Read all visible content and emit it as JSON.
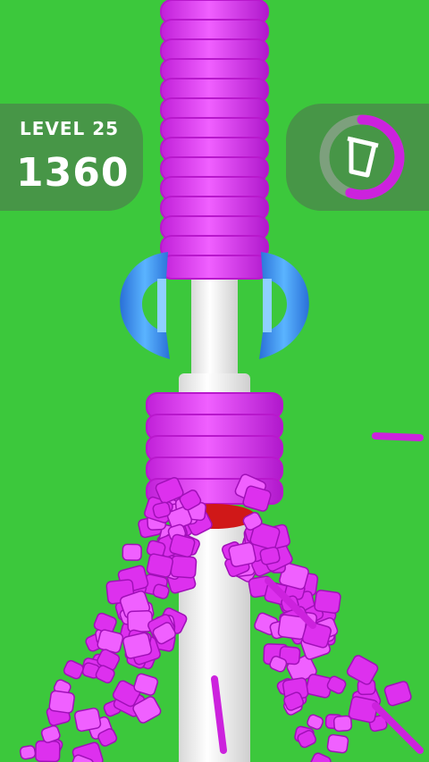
{
  "hud": {
    "level_label": "LEVEL 25",
    "score": "1360",
    "progress": 0.55,
    "progress_color": "#cc22dd",
    "progress_track_color": "#7da07d",
    "cup_icon": "cup-icon"
  },
  "colors": {
    "background": "#3cc83c",
    "rings": "#e040f0",
    "pole": "#f2f2f2",
    "claws": "#3a8ff0",
    "debris": "#dd30ee"
  }
}
